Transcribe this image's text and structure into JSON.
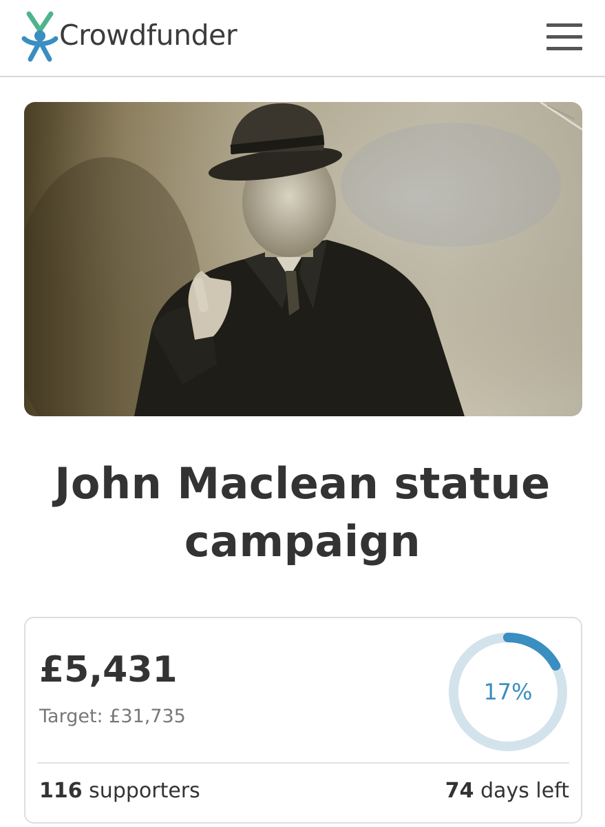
{
  "header": {
    "brand": "Crowdfunder",
    "logo_icon": "crowdfunder-logo-icon",
    "menu_icon": "hamburger-menu-icon",
    "brand_colors": {
      "green": "#4fb48d",
      "blue": "#3a8ec0",
      "text": "#3b3b3b"
    }
  },
  "hero": {
    "image": "sepia-portrait-photo"
  },
  "campaign": {
    "title": "John Maclean statue campaign"
  },
  "funding": {
    "raised": "£5,431",
    "target_label": "Target: £31,735",
    "percent": 17,
    "percent_label": "17%",
    "supporters_count": "116",
    "supporters_label": "supporters",
    "days_count": "74",
    "days_label": "days left",
    "ring_color": "#3a8ec0",
    "ring_track_color": "#d3e3ec"
  }
}
